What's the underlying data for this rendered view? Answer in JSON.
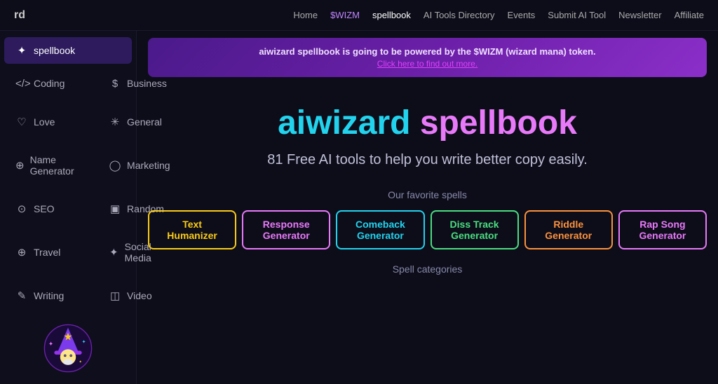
{
  "topNav": {
    "brand": "rd",
    "links": [
      {
        "label": "Home",
        "active": false,
        "highlight": false
      },
      {
        "label": "$WIZM",
        "active": false,
        "highlight": true
      },
      {
        "label": "spellbook",
        "active": true,
        "highlight": false
      },
      {
        "label": "AI Tools Directory",
        "active": false,
        "highlight": false
      },
      {
        "label": "Events",
        "active": false,
        "highlight": false
      },
      {
        "label": "Submit AI Tool",
        "active": false,
        "highlight": false
      },
      {
        "label": "Newsletter",
        "active": false,
        "highlight": false
      },
      {
        "label": "Affiliate",
        "active": false,
        "highlight": false
      }
    ]
  },
  "sidebar": {
    "topItem": {
      "label": "spellbook",
      "icon": "✦",
      "active": true
    },
    "items": [
      {
        "label": "Coding",
        "icon": "</>",
        "col": 1
      },
      {
        "label": "Business",
        "icon": "$",
        "col": 2
      },
      {
        "label": "General",
        "icon": "✳",
        "col": 2
      },
      {
        "label": "Love",
        "icon": "♡",
        "col": 1
      },
      {
        "label": "Marketing",
        "icon": "◯",
        "col": 2
      },
      {
        "label": "Name Generator",
        "icon": "⊕",
        "col": 1
      },
      {
        "label": "Random",
        "icon": "▣",
        "col": 2
      },
      {
        "label": "SEO",
        "icon": "⊙",
        "col": 1
      },
      {
        "label": "Social Media",
        "icon": "✦",
        "col": 2
      },
      {
        "label": "Travel",
        "icon": "⊕",
        "col": 1
      },
      {
        "label": "Video",
        "icon": "◫",
        "col": 2
      },
      {
        "label": "Writing",
        "icon": "✎",
        "col": 1
      }
    ]
  },
  "announcement": {
    "mainText": "aiwizard spellbook is going to be powered by the $WIZM (wizard mana) token.",
    "linkText": "Click here to find out more."
  },
  "hero": {
    "titleCyan": "aiwizard",
    "titlePink": "spellbook",
    "subtitle": "81 Free AI tools to help you write better copy easily."
  },
  "favoriteSpells": {
    "label": "Our favorite spells",
    "cards": [
      {
        "label": "Text Humanizer",
        "color": "yellow"
      },
      {
        "label": "Response Generator",
        "color": "pink"
      },
      {
        "label": "Comeback Generator",
        "color": "cyan"
      },
      {
        "label": "Diss Track Generator",
        "color": "green"
      },
      {
        "label": "Riddle Generator",
        "color": "orange"
      },
      {
        "label": "Rap Song Generator",
        "color": "pink"
      }
    ]
  },
  "spellCategories": {
    "label": "Spell categories"
  }
}
